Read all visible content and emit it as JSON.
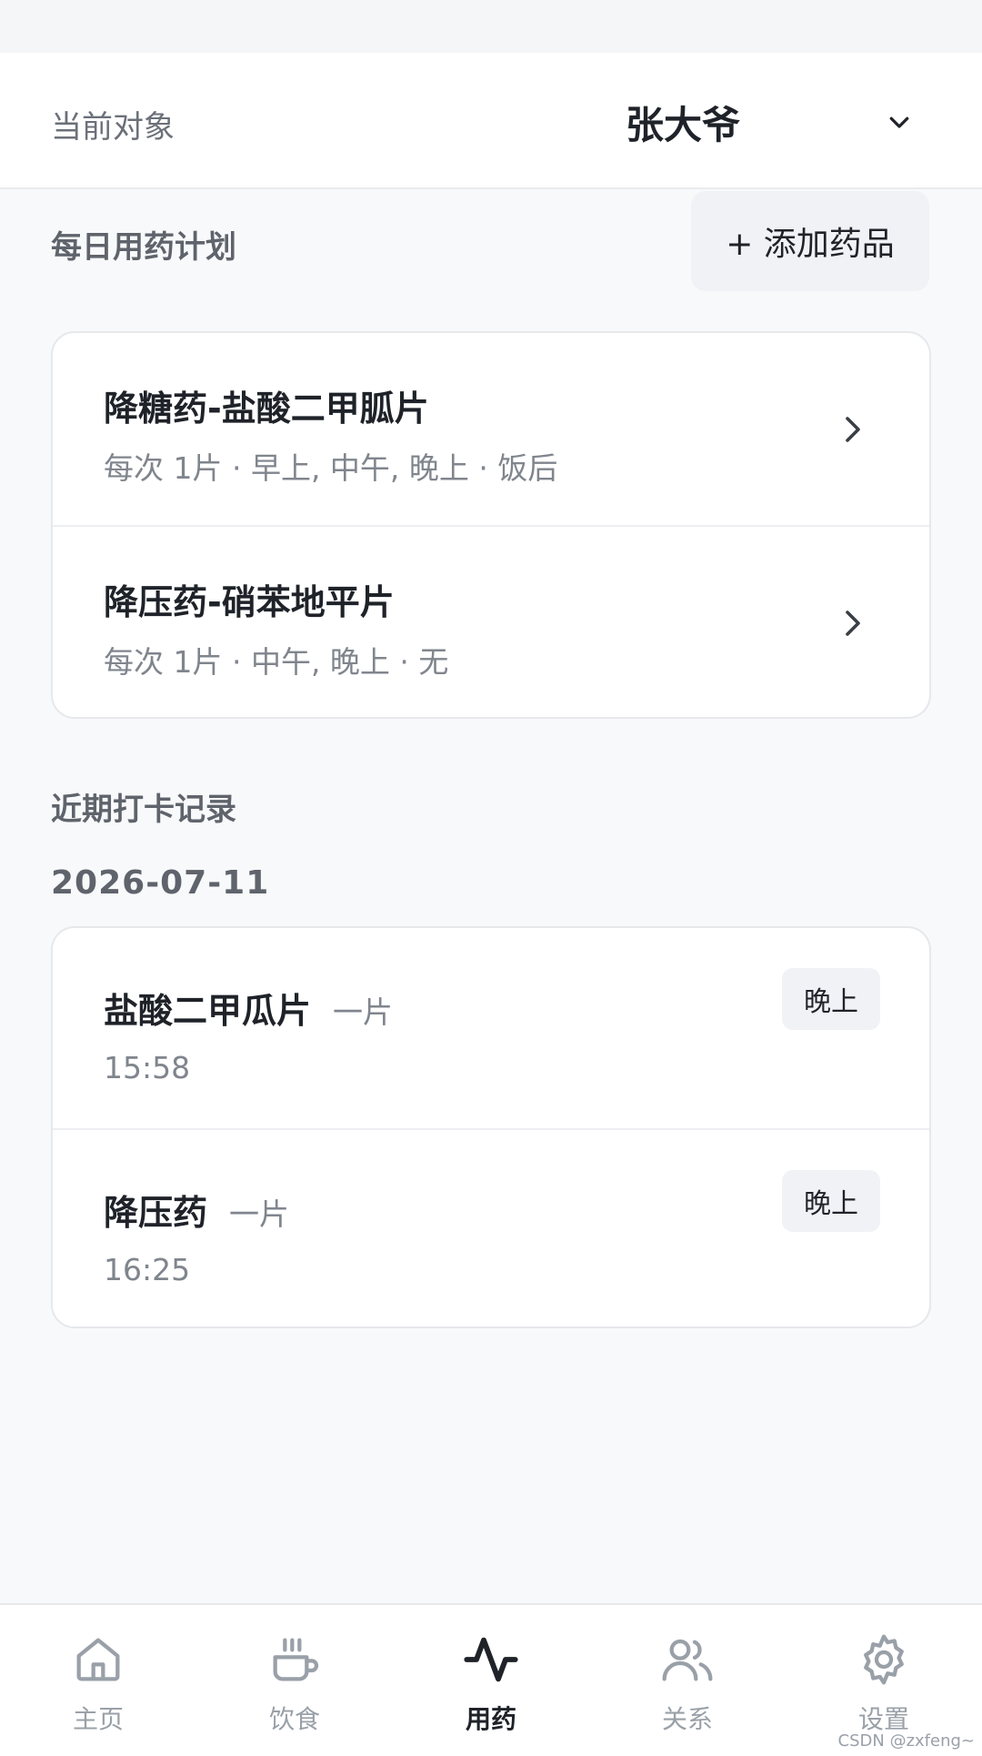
{
  "header": {
    "label": "当前对象",
    "subject": "张大爷"
  },
  "plan": {
    "title": "每日用药计划",
    "add_button": "+ 添加药品",
    "items": [
      {
        "title": "降糖药-盐酸二甲胍片",
        "detail": "每次 1片 · 早上, 中午, 晚上 · 饭后"
      },
      {
        "title": "降压药-硝苯地平片",
        "detail": "每次 1片 · 中午, 晚上 · 无"
      }
    ]
  },
  "records": {
    "title": "近期打卡记录",
    "date": "2026-07-11",
    "items": [
      {
        "name": "盐酸二甲瓜片",
        "dose": "一片",
        "time": "15:58",
        "period": "晚上"
      },
      {
        "name": "降压药",
        "dose": "一片",
        "time": "16:25",
        "period": "晚上"
      }
    ]
  },
  "tabbar": {
    "items": [
      {
        "label": "主页",
        "icon": "home-icon"
      },
      {
        "label": "饮食",
        "icon": "cup-icon"
      },
      {
        "label": "用药",
        "icon": "activity-icon"
      },
      {
        "label": "关系",
        "icon": "users-icon"
      },
      {
        "label": "设置",
        "icon": "gear-icon"
      }
    ],
    "active_index": 2
  },
  "watermark": "CSDN @zxfeng~",
  "colors": {
    "background": "#f8f9fb",
    "card": "#ffffff",
    "text_primary": "#1f2329",
    "text_secondary": "#80858d",
    "tab_inactive": "#9aa0a8"
  }
}
